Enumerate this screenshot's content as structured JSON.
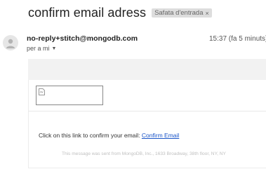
{
  "subject": "confirm email adress",
  "label": {
    "text": "Safata d'entrada",
    "remove": "×"
  },
  "sender": {
    "email": "no-reply+stitch@mongodb.com",
    "time": "15:37 (fa 5 minuts)",
    "to": "per a mi"
  },
  "icons": {
    "avatar": "person-icon",
    "image": "broken-image-icon",
    "caret": "caret-down-icon"
  },
  "body": {
    "confirm_text": "Click on this link to confirm your email: ",
    "link_text": "Confirm Email",
    "footer": "This message was sent from MongoDB, Inc., 1633 Broadway, 38th floor, NY, NY"
  },
  "colors": {
    "link": "#1a55c8",
    "label_bg": "#dddddd",
    "header_band": "#f2f2f2"
  }
}
